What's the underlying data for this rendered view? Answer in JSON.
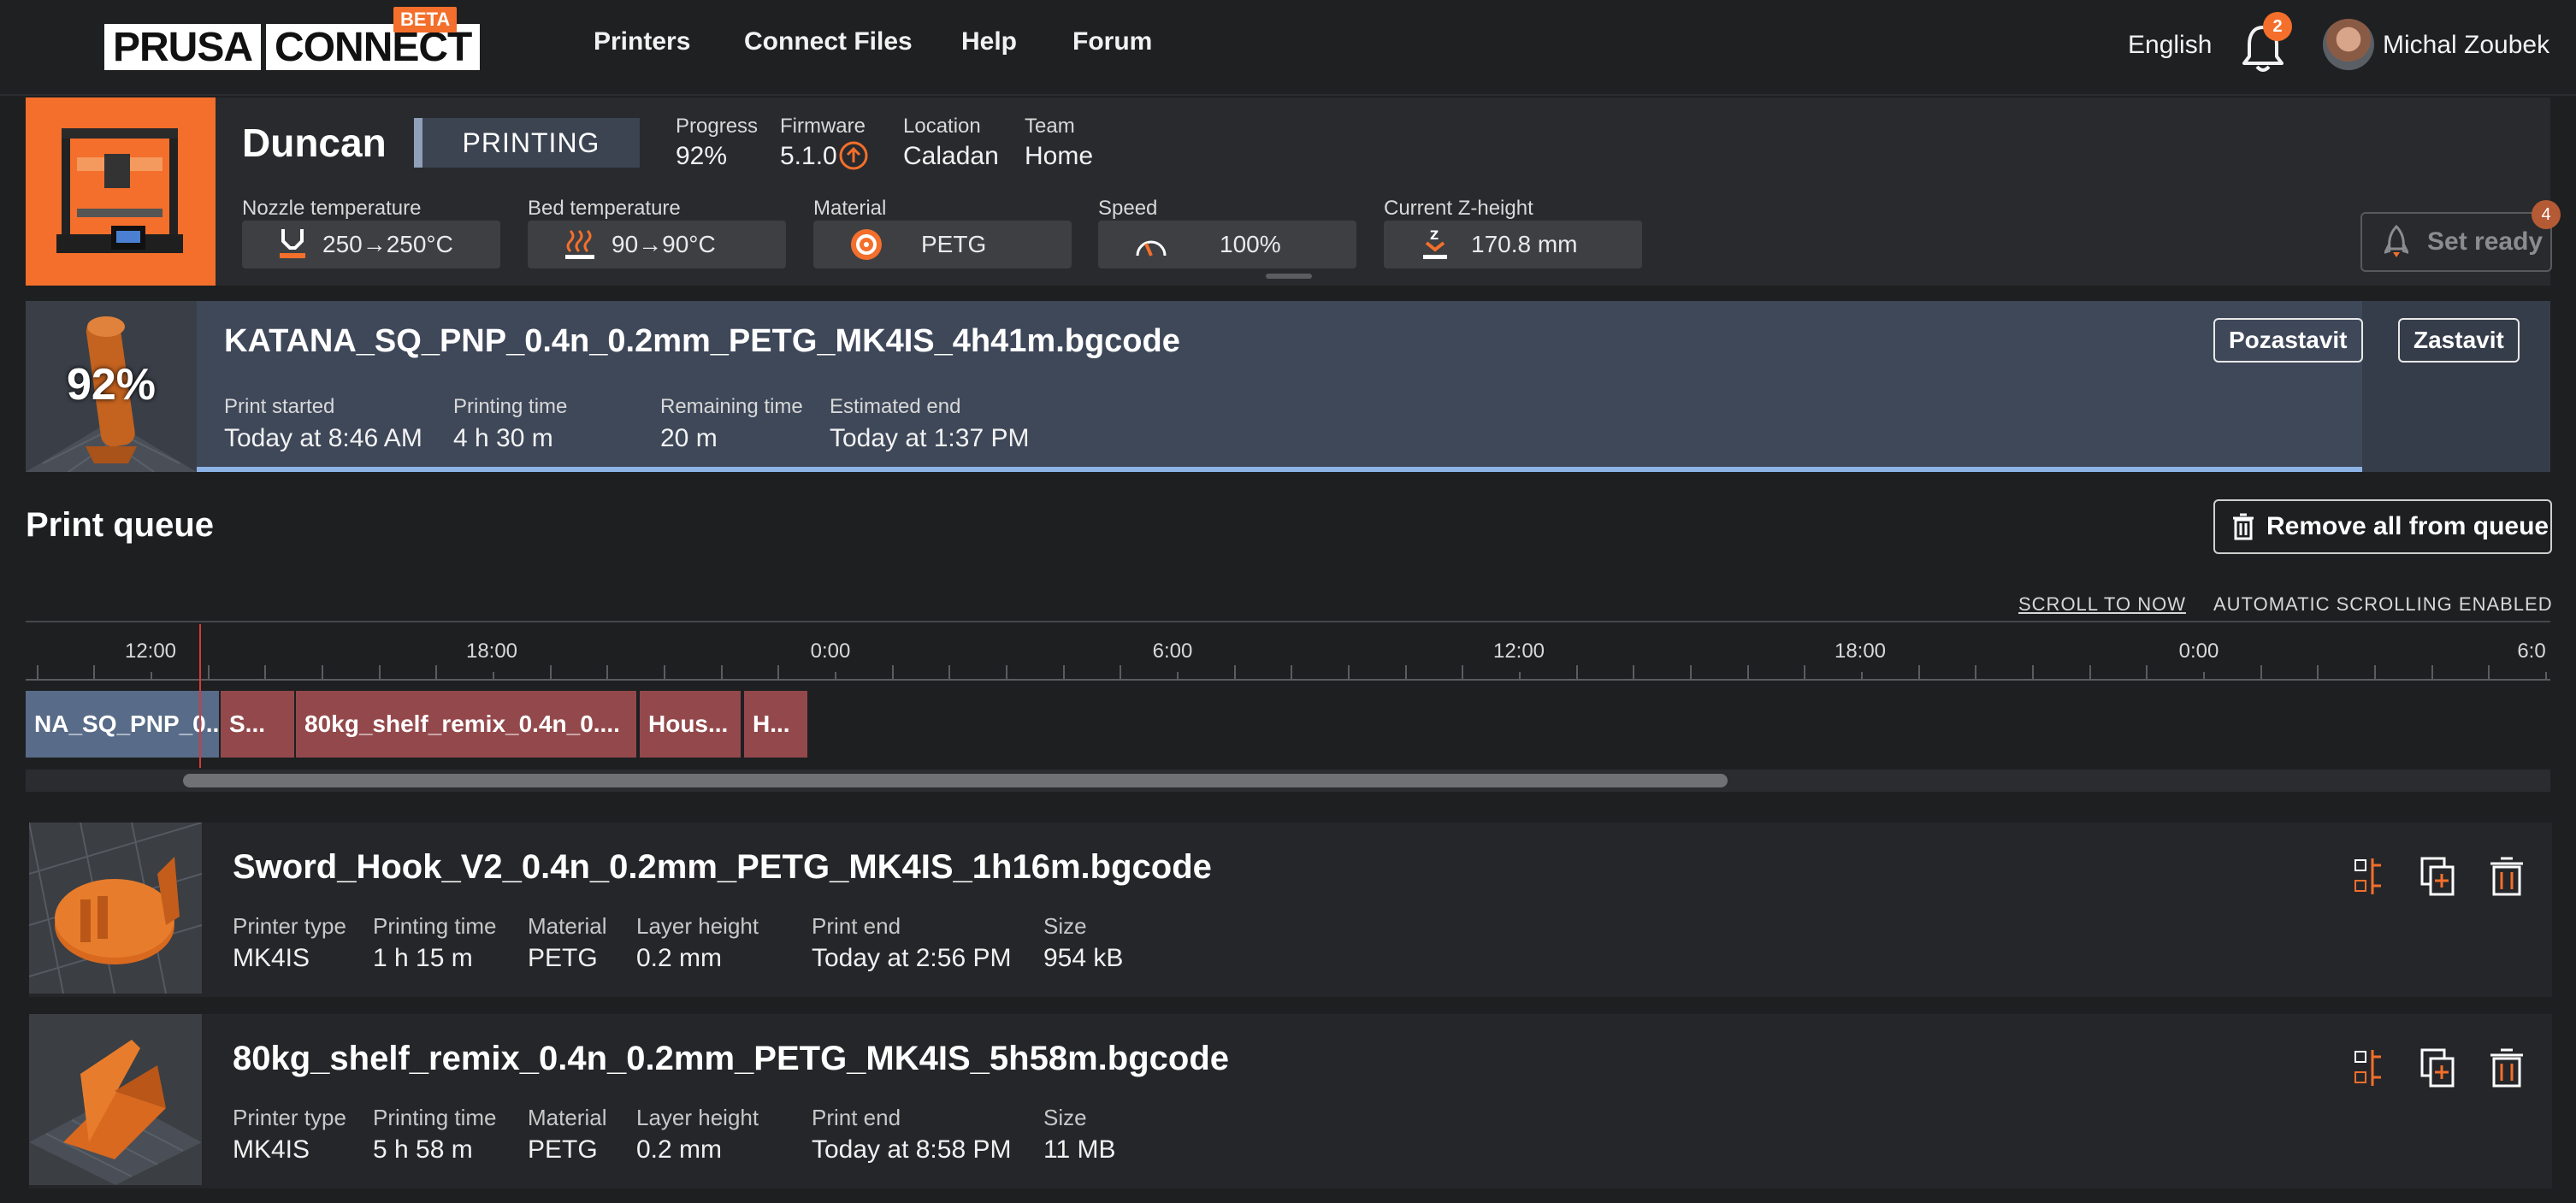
{
  "nav": {
    "logo_left": "PRUSA",
    "logo_right": "CONNECT",
    "beta": "BETA",
    "links": [
      "Printers",
      "Connect Files",
      "Help",
      "Forum"
    ],
    "language": "English",
    "notifications": "2",
    "user": "Michal Zoubek"
  },
  "printer": {
    "name": "Duncan",
    "state": "PRINTING",
    "progress_label": "Progress",
    "progress_value": "92%",
    "firmware_label": "Firmware",
    "firmware_value": "5.1.0",
    "location_label": "Location",
    "location_value": "Caladan",
    "team_label": "Team",
    "team_value": "Home",
    "nozzle_label": "Nozzle temperature",
    "nozzle_value": "250→250°C",
    "bed_label": "Bed temperature",
    "bed_value": "90→90°C",
    "material_label": "Material",
    "material_value": "PETG",
    "speed_label": "Speed",
    "speed_value": "100%",
    "z_label": "Current Z-height",
    "z_value": "170.8 mm",
    "set_ready": "Set ready",
    "set_ready_badge": "4"
  },
  "job": {
    "percent": "92%",
    "progress": 0.92,
    "name": "KATANA_SQ_PNP_0.4n_0.2mm_PETG_MK4IS_4h41m.bgcode",
    "pause": "Pozastavit",
    "stop": "Zastavit",
    "started_label": "Print started",
    "started_value": "Today at 8:46 AM",
    "ptime_label": "Printing time",
    "ptime_value": "4 h 30 m",
    "remaining_label": "Remaining time",
    "remaining_value": "20 m",
    "end_label": "Estimated end",
    "end_value": "Today at 1:37 PM"
  },
  "queue": {
    "title": "Print queue",
    "remove_all": "Remove all from queue",
    "scroll_to_now": "SCROLL TO NOW",
    "auto_scroll": "AUTOMATIC SCROLLING ENABLED",
    "timeline_labels": [
      "12:00",
      "18:00",
      "0:00",
      "6:00",
      "12:00",
      "18:00",
      "0:00",
      "6:0"
    ],
    "blocks": [
      "NA_SQ_PNP_0....",
      "S...",
      "80kg_shelf_remix_0.4n_0....",
      "Hous...",
      "H..."
    ],
    "items": [
      {
        "name": "Sword_Hook_V2_0.4n_0.2mm_PETG_MK4IS_1h16m.bgcode",
        "printer_type_label": "Printer type",
        "printer_type": "MK4IS",
        "ptime_label": "Printing time",
        "ptime": "1 h 15 m",
        "material_label": "Material",
        "material": "PETG",
        "layer_label": "Layer height",
        "layer": "0.2 mm",
        "end_label": "Print end",
        "end": "Today at 2:56 PM",
        "size_label": "Size",
        "size": "954 kB"
      },
      {
        "name": "80kg_shelf_remix_0.4n_0.2mm_PETG_MK4IS_5h58m.bgcode",
        "printer_type_label": "Printer type",
        "printer_type": "MK4IS",
        "ptime_label": "Printing time",
        "ptime": "5 h 58 m",
        "material_label": "Material",
        "material": "PETG",
        "layer_label": "Layer height",
        "layer": "0.2 mm",
        "end_label": "Print end",
        "end": "Today at 8:58 PM",
        "size_label": "Size",
        "size": "11 MB"
      }
    ]
  },
  "colors": {
    "accent": "#f36f2b",
    "printing": "#3e4859",
    "queue_block": "#93494c",
    "progress": "#8db3e6"
  }
}
